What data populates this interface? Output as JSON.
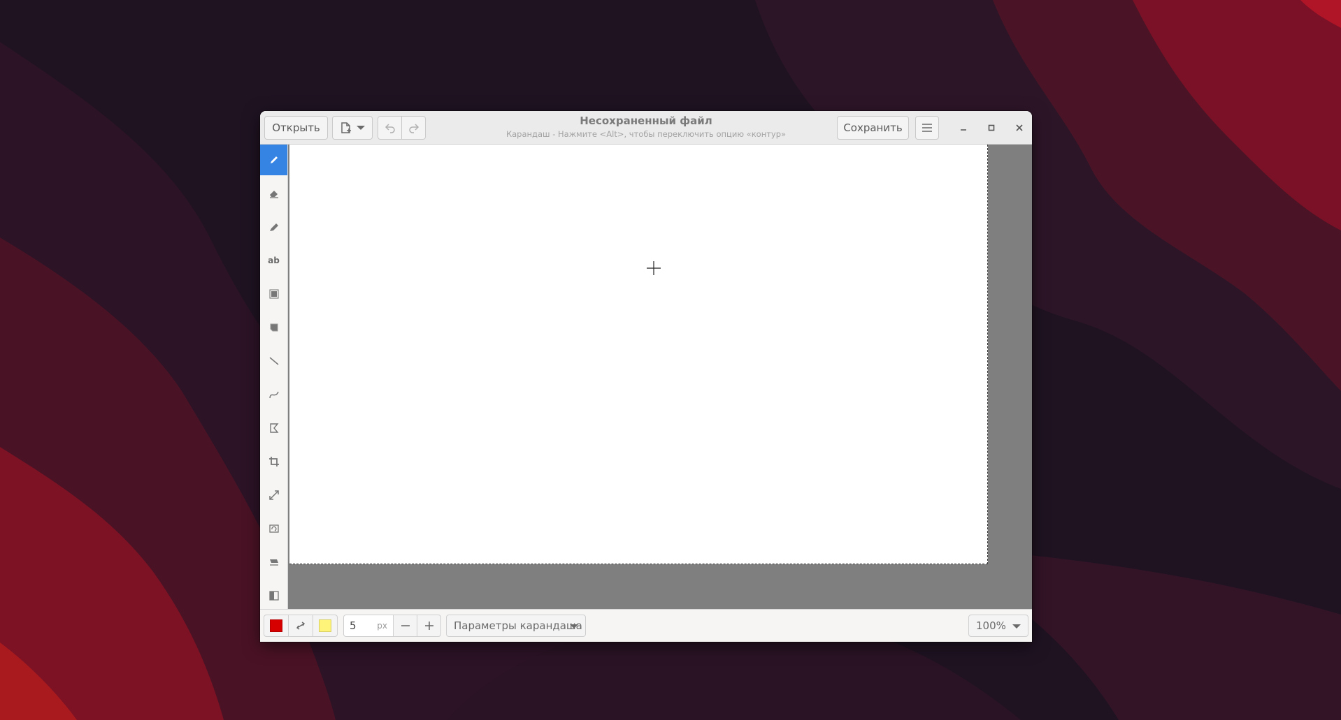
{
  "colors": {
    "accent": "#3584e4",
    "primary_color": "#d60000",
    "secondary_color": "#fff47a",
    "canvas_background": "#ffffff",
    "canvas_surround": "#7f7f7f"
  },
  "header": {
    "open_label": "Открыть",
    "new_icon": "new-image-icon",
    "undo_icon": "undo-icon",
    "redo_icon": "redo-icon",
    "title": "Несохраненный файл",
    "subtitle": "Карандаш - Нажмите <Alt>, чтобы переключить опцию «контур»",
    "save_label": "Сохранить",
    "menu_icon": "hamburger-menu-icon",
    "minimize_icon": "minimize-icon",
    "maximize_icon": "maximize-icon",
    "close_icon": "close-icon"
  },
  "tools": [
    {
      "name": "pencil",
      "icon": "pencil-icon",
      "active": true
    },
    {
      "name": "eraser",
      "icon": "eraser-icon",
      "active": false
    },
    {
      "name": "highlighter",
      "icon": "highlighter-icon",
      "active": false
    },
    {
      "name": "text",
      "icon": "text-icon",
      "label": "ab",
      "active": false
    },
    {
      "name": "rectangle-selection",
      "icon": "rect-select-icon",
      "active": false
    },
    {
      "name": "free-selection",
      "icon": "free-select-icon",
      "active": false
    },
    {
      "name": "line",
      "icon": "line-icon",
      "active": false
    },
    {
      "name": "curve",
      "icon": "curve-icon",
      "active": false
    },
    {
      "name": "shape",
      "icon": "shape-icon",
      "active": false
    },
    {
      "name": "crop",
      "icon": "crop-icon",
      "active": false
    },
    {
      "name": "scale",
      "icon": "scale-icon",
      "active": false
    },
    {
      "name": "rotate",
      "icon": "rotate-icon",
      "active": false
    },
    {
      "name": "skew",
      "icon": "skew-icon",
      "active": false
    },
    {
      "name": "filters",
      "icon": "filters-icon",
      "active": false
    }
  ],
  "bottom": {
    "swap_icon": "swap-colors-icon",
    "size_value": "5",
    "size_unit": "px",
    "decrease_icon": "minus-icon",
    "increase_icon": "plus-icon",
    "tool_options_label": "Параметры карандаша",
    "zoom_label": "100%"
  }
}
